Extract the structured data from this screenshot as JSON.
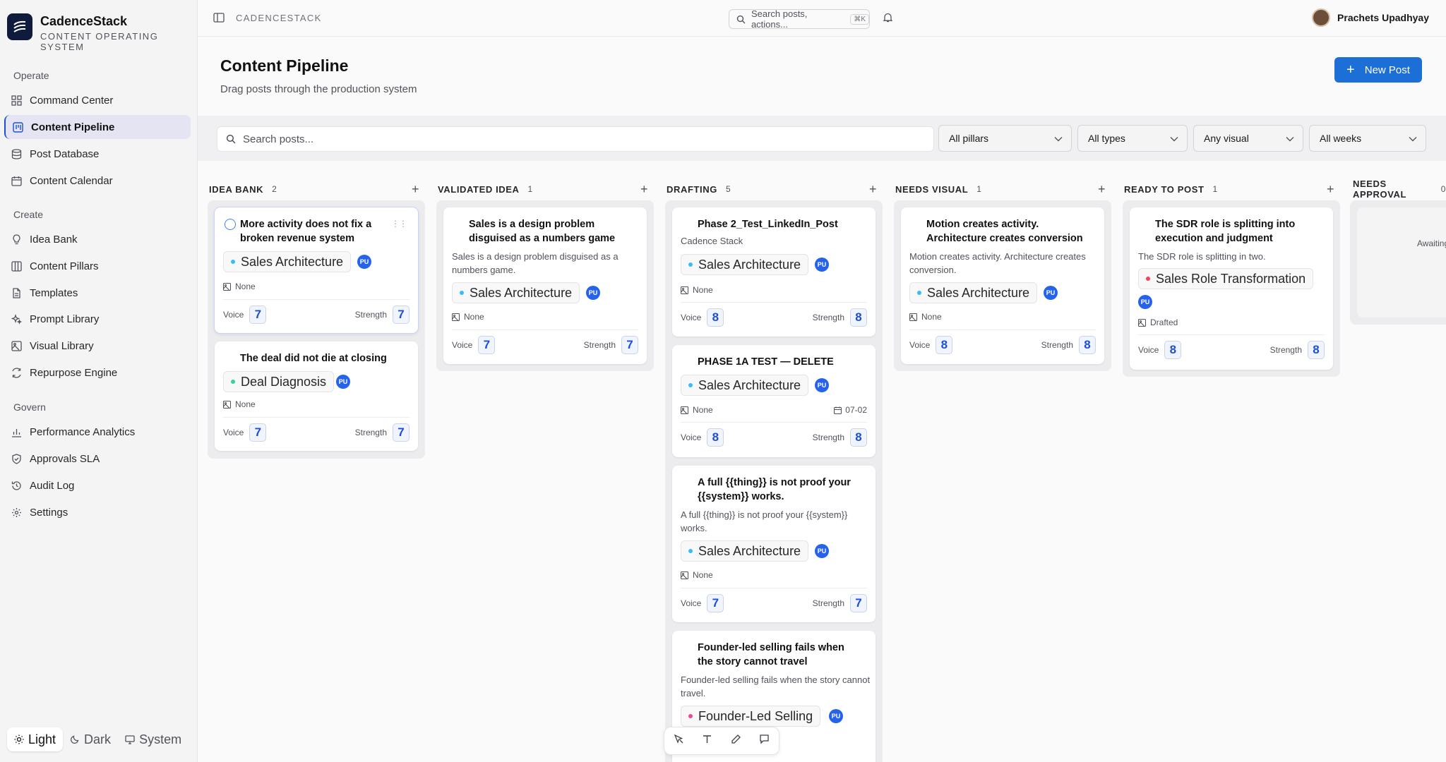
{
  "brand": {
    "name": "CadenceStack",
    "tagline": "CONTENT OPERATING SYSTEM"
  },
  "sidebar": {
    "sections": [
      {
        "title": "Operate",
        "items": [
          {
            "label": "Command Center",
            "icon": "grid-icon"
          },
          {
            "label": "Content Pipeline",
            "icon": "kanban-icon",
            "active": true
          },
          {
            "label": "Post Database",
            "icon": "database-icon"
          },
          {
            "label": "Content Calendar",
            "icon": "calendar-icon"
          }
        ]
      },
      {
        "title": "Create",
        "items": [
          {
            "label": "Idea Bank",
            "icon": "lightbulb-icon"
          },
          {
            "label": "Content Pillars",
            "icon": "columns-icon"
          },
          {
            "label": "Templates",
            "icon": "file-icon"
          },
          {
            "label": "Prompt Library",
            "icon": "sparkles-icon"
          },
          {
            "label": "Visual Library",
            "icon": "image-icon"
          },
          {
            "label": "Repurpose Engine",
            "icon": "refresh-icon"
          }
        ]
      },
      {
        "title": "Govern",
        "items": [
          {
            "label": "Performance Analytics",
            "icon": "bar-chart-icon"
          },
          {
            "label": "Approvals SLA",
            "icon": "shield-check-icon"
          },
          {
            "label": "Audit Log",
            "icon": "history-icon"
          },
          {
            "label": "Settings",
            "icon": "gear-icon"
          }
        ]
      }
    ],
    "theme": {
      "light": "Light",
      "dark": "Dark",
      "system": "System"
    }
  },
  "topbar": {
    "workspace": "CADENCESTACK",
    "search_placeholder": "Search posts, actions...",
    "shortcut": "⌘K",
    "user_name": "Prachets Upadhyay"
  },
  "page": {
    "title": "Content Pipeline",
    "subtitle": "Drag posts through the production system",
    "new_button": "New Post"
  },
  "filters": {
    "search_placeholder": "Search posts...",
    "pillars": "All pillars",
    "types": "All types",
    "visual": "Any visual",
    "weeks": "All weeks"
  },
  "labels": {
    "voice": "Voice",
    "strength": "Strength",
    "owner": "PU"
  },
  "colors": {
    "accent": "#1d6fd8",
    "sales_architecture": "#38bdf8",
    "deal_diagnosis": "#34d399",
    "sales_role": "#f43f5e",
    "founder_led": "#ec4899"
  },
  "columns": [
    {
      "name": "IDEA BANK",
      "count": "2",
      "cards": [
        {
          "title": "More activity does not fix a broken revenue system",
          "pillar": "Sales Architecture",
          "visual": "None",
          "voice": "7",
          "strength": "7"
        },
        {
          "title": "The deal did not die at closing",
          "pillar": "Deal Diagnosis",
          "visual": "None",
          "voice": "7",
          "strength": "7"
        }
      ]
    },
    {
      "name": "VALIDATED IDEA",
      "count": "1",
      "cards": [
        {
          "title": "Sales is a design problem disguised as a numbers game",
          "desc": "Sales is a design problem disguised as a numbers game.",
          "pillar": "Sales Architecture",
          "visual": "None",
          "voice": "7",
          "strength": "7"
        }
      ]
    },
    {
      "name": "DRAFTING",
      "count": "5",
      "cards": [
        {
          "title": "Phase 2_Test_LinkedIn_Post",
          "sub": "Cadence Stack",
          "pillar": "Sales Architecture",
          "visual": "None",
          "voice": "8",
          "strength": "8"
        },
        {
          "title": "PHASE 1A TEST — DELETE",
          "pillar": "Sales Architecture",
          "visual": "None",
          "date": "07-02",
          "voice": "8",
          "strength": "8"
        },
        {
          "title": "A full {{thing}} is not proof your {{system}} works.",
          "desc": "A full {{thing}} is not proof your {{system}} works.",
          "pillar": "Sales Architecture",
          "visual": "None",
          "voice": "7",
          "strength": "7"
        },
        {
          "title": "Founder-led selling fails when the story cannot travel",
          "desc": "Founder-led selling fails when the story cannot travel.",
          "pillar": "Founder-Led Selling"
        }
      ]
    },
    {
      "name": "NEEDS VISUAL",
      "count": "1",
      "cards": [
        {
          "title": "Motion creates activity. Architecture creates conversion",
          "desc": "Motion creates activity. Architecture creates conversion.",
          "pillar": "Sales Architecture",
          "visual": "None",
          "voice": "8",
          "strength": "8"
        }
      ]
    },
    {
      "name": "READY TO POST",
      "count": "1",
      "cards": [
        {
          "title": "The SDR role is splitting into execution and judgment",
          "desc": "The SDR role is splitting in two.",
          "pillar": "Sales Role Transformation",
          "visual": "Drafted",
          "voice": "8",
          "strength": "8"
        }
      ]
    },
    {
      "name": "NEEDS APPROVAL",
      "count": "0",
      "placeholder": "Awaiting"
    }
  ]
}
